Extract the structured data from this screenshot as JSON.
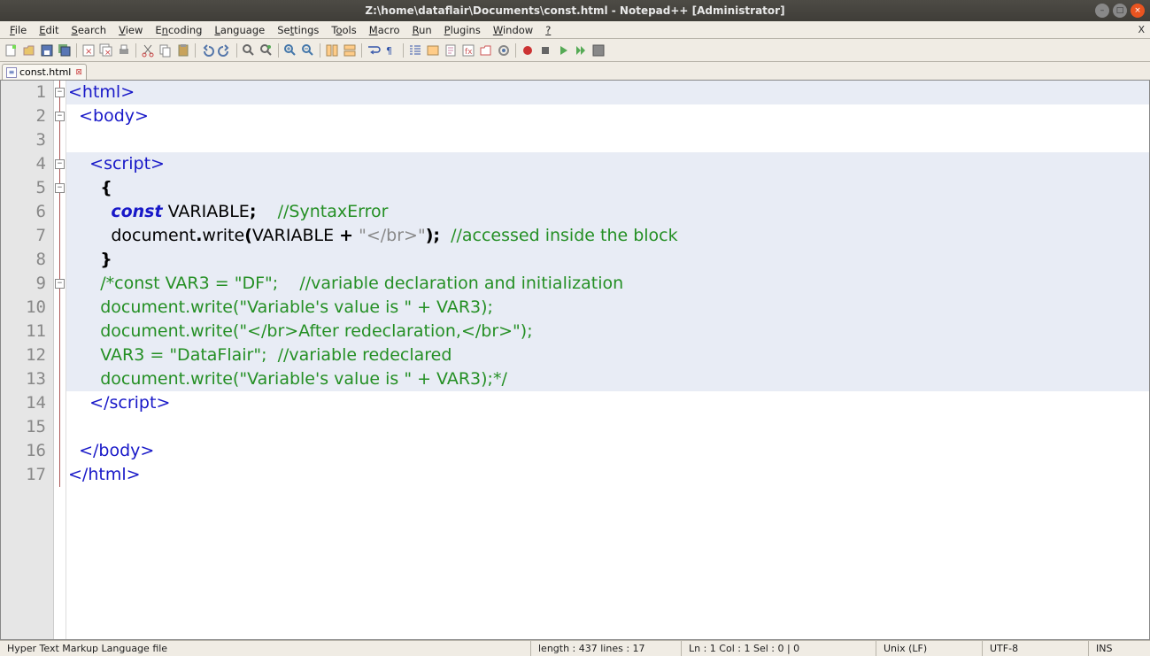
{
  "titlebar": {
    "title": "Z:\\home\\dataflair\\Documents\\const.html - Notepad++ [Administrator]"
  },
  "menubar": {
    "items": [
      "File",
      "Edit",
      "Search",
      "View",
      "Encoding",
      "Language",
      "Settings",
      "Tools",
      "Macro",
      "Run",
      "Plugins",
      "Window",
      "?"
    ]
  },
  "tab": {
    "label": "const.html"
  },
  "code": {
    "lines": [
      {
        "n": 1,
        "hl": true,
        "fold": "-",
        "segs": [
          [
            "tag",
            "<html>"
          ]
        ]
      },
      {
        "n": 2,
        "hl": false,
        "fold": "-",
        "segs": [
          [
            "ws",
            "  "
          ],
          [
            "tag",
            "<body>"
          ]
        ]
      },
      {
        "n": 3,
        "hl": false,
        "segs": []
      },
      {
        "n": 4,
        "hl": true,
        "fold": "-",
        "segs": [
          [
            "ws",
            "    "
          ],
          [
            "tag",
            "<script>"
          ]
        ]
      },
      {
        "n": 5,
        "hl": true,
        "fold": "-",
        "segs": [
          [
            "ws",
            "      "
          ],
          [
            "punc",
            "{"
          ]
        ]
      },
      {
        "n": 6,
        "hl": true,
        "segs": [
          [
            "ws",
            "        "
          ],
          [
            "key",
            "const"
          ],
          [
            "ws",
            " "
          ],
          [
            "ident",
            "VARIABLE"
          ],
          [
            "punc",
            ";"
          ],
          [
            "ws",
            "    "
          ],
          [
            "cmt",
            "//SyntaxError"
          ]
        ]
      },
      {
        "n": 7,
        "hl": true,
        "segs": [
          [
            "ws",
            "        "
          ],
          [
            "ident",
            "document"
          ],
          [
            "punc",
            "."
          ],
          [
            "ident",
            "write"
          ],
          [
            "punc",
            "("
          ],
          [
            "ident",
            "VARIABLE "
          ],
          [
            "punc",
            "+"
          ],
          [
            "ws",
            " "
          ],
          [
            "str",
            "\"</br>\""
          ],
          [
            "punc",
            ");"
          ],
          [
            "ws",
            "  "
          ],
          [
            "cmt",
            "//accessed inside the block"
          ]
        ]
      },
      {
        "n": 8,
        "hl": true,
        "segs": [
          [
            "ws",
            "      "
          ],
          [
            "punc",
            "}"
          ]
        ]
      },
      {
        "n": 9,
        "hl": true,
        "fold": "-",
        "segs": [
          [
            "ws",
            "      "
          ],
          [
            "cmt",
            "/*const VAR3 = \"DF\";    //variable declaration and initialization"
          ]
        ]
      },
      {
        "n": 10,
        "hl": true,
        "segs": [
          [
            "ws",
            "      "
          ],
          [
            "cmt",
            "document.write(\"Variable's value is \" + VAR3);"
          ]
        ]
      },
      {
        "n": 11,
        "hl": true,
        "segs": [
          [
            "ws",
            "      "
          ],
          [
            "cmt",
            "document.write(\"</br>After redeclaration,</br>\");"
          ]
        ]
      },
      {
        "n": 12,
        "hl": true,
        "segs": [
          [
            "ws",
            "      "
          ],
          [
            "cmt",
            "VAR3 = \"DataFlair\";  //variable redeclared"
          ]
        ]
      },
      {
        "n": 13,
        "hl": true,
        "segs": [
          [
            "ws",
            "      "
          ],
          [
            "cmt",
            "document.write(\"Variable's value is \" + VAR3);*/"
          ]
        ]
      },
      {
        "n": 14,
        "hl": false,
        "segs": [
          [
            "ws",
            "    "
          ],
          [
            "tag",
            "</script>"
          ]
        ]
      },
      {
        "n": 15,
        "hl": false,
        "segs": []
      },
      {
        "n": 16,
        "hl": false,
        "segs": [
          [
            "ws",
            "  "
          ],
          [
            "tag",
            "</body>"
          ]
        ]
      },
      {
        "n": 17,
        "hl": false,
        "segs": [
          [
            "tag",
            "</html>"
          ]
        ]
      }
    ]
  },
  "statusbar": {
    "filetype": "Hyper Text Markup Language file",
    "length": "length : 437    lines : 17",
    "pos": "Ln : 1    Col : 1    Sel : 0 | 0",
    "eol": "Unix (LF)",
    "enc": "UTF-8",
    "mode": "INS"
  }
}
